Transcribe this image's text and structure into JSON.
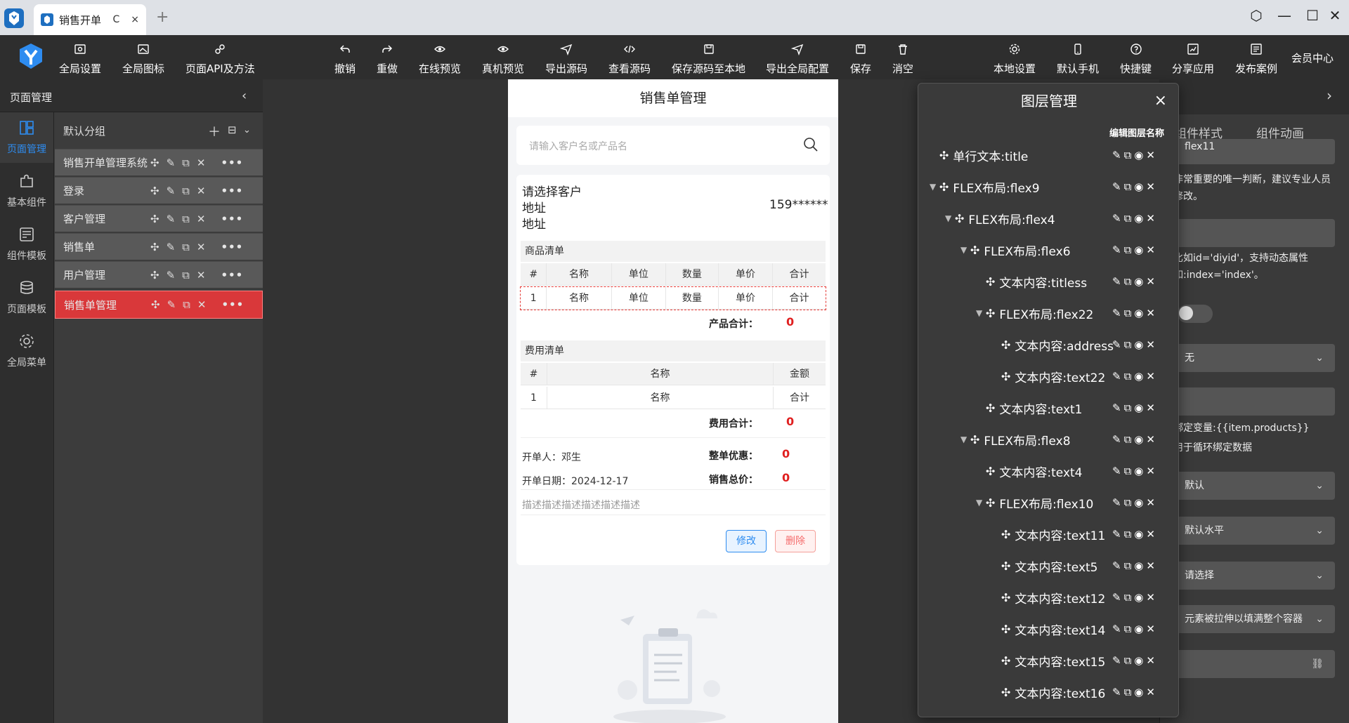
{
  "browser": {
    "tab_title": "销售开单",
    "tab_reload": "C",
    "tab_close": "×",
    "new_tab": "+"
  },
  "toolbar": {
    "left": [
      {
        "label": "全局设置",
        "icon": "settings-window-icon"
      },
      {
        "label": "全局图标",
        "icon": "image-icon"
      },
      {
        "label": "页面API及方法",
        "icon": "api-icon"
      }
    ],
    "center": [
      {
        "label": "撤销",
        "icon": "undo-icon"
      },
      {
        "label": "重做",
        "icon": "redo-icon"
      },
      {
        "label": "在线预览",
        "icon": "eye-icon"
      },
      {
        "label": "真机预览",
        "icon": "eye-icon"
      },
      {
        "label": "导出源码",
        "icon": "send-icon"
      },
      {
        "label": "查看源码",
        "icon": "code-icon"
      },
      {
        "label": "保存源码至本地",
        "icon": "save-icon"
      },
      {
        "label": "导出全局配置",
        "icon": "send-icon"
      },
      {
        "label": "保存",
        "icon": "save-icon"
      },
      {
        "label": "消空",
        "icon": "trash-icon"
      }
    ],
    "right": [
      {
        "label": "本地设置",
        "icon": "gear-icon"
      },
      {
        "label": "默认手机",
        "icon": "phone-icon"
      },
      {
        "label": "快捷键",
        "icon": "help-icon"
      },
      {
        "label": "分享应用",
        "icon": "share-icon"
      },
      {
        "label": "发布案例",
        "icon": "publish-icon"
      }
    ],
    "vip": "会员中心"
  },
  "left_nav": [
    {
      "label": "页面管理",
      "icon": "layout-icon",
      "active": true
    },
    {
      "label": "基本组件",
      "icon": "puzzle-icon",
      "active": false
    },
    {
      "label": "组件模板",
      "icon": "template-icon",
      "active": false
    },
    {
      "label": "页面模板",
      "icon": "database-icon",
      "active": false
    },
    {
      "label": "全局菜单",
      "icon": "gear-icon",
      "active": false
    }
  ],
  "page_panel": {
    "title": "页面管理",
    "group": "默认分组",
    "pages": [
      {
        "name": "销售开单管理系统",
        "active": false
      },
      {
        "name": "登录",
        "active": false
      },
      {
        "name": "客户管理",
        "active": false
      },
      {
        "name": "销售单",
        "active": false
      },
      {
        "name": "用户管理",
        "active": false
      },
      {
        "name": "销售单管理",
        "active": true
      }
    ]
  },
  "phone": {
    "title": "销售单管理",
    "search_placeholder": "请输入客户名或产品名",
    "customer": {
      "line1": "请选择客户",
      "line2": "地址",
      "line3": "地址",
      "phone": "159******"
    },
    "products": {
      "header": "商品清单",
      "columns": [
        "#",
        "名称",
        "单位",
        "数量",
        "单价",
        "合计"
      ],
      "row": [
        "1",
        "名称",
        "单位",
        "数量",
        "单价",
        "合计"
      ],
      "sum_label": "产品合计：",
      "sum_value": "0"
    },
    "fees": {
      "header": "费用清单",
      "columns": [
        "#",
        "名称",
        "金额"
      ],
      "row": [
        "1",
        "名称",
        "合计"
      ],
      "sum_label": "费用合计：",
      "sum_value": "0"
    },
    "footer": {
      "creator": "开单人：邓生",
      "date": "开单日期：2024-12-17",
      "discount_label": "整单优惠：",
      "discount_value": "0",
      "total_label": "销售总价：",
      "total_value": "0",
      "desc": "描述描述描述描述描述描述"
    },
    "btn_edit": "修改",
    "btn_delete": "删除"
  },
  "layers": {
    "title": "图层管理",
    "close": "×",
    "subtitle": "编辑图层名称",
    "items": [
      {
        "label": "单行文本:title",
        "depth": 0,
        "arrow": ""
      },
      {
        "label": "FLEX布局:flex9",
        "depth": 0,
        "arrow": "▼"
      },
      {
        "label": "FLEX布局:flex4",
        "depth": 1,
        "arrow": "▼"
      },
      {
        "label": "FLEX布局:flex6",
        "depth": 2,
        "arrow": "▼"
      },
      {
        "label": "文本内容:titless",
        "depth": 3,
        "arrow": ""
      },
      {
        "label": "FLEX布局:flex22",
        "depth": 3,
        "arrow": "▼"
      },
      {
        "label": "文本内容:address",
        "depth": 4,
        "arrow": ""
      },
      {
        "label": "文本内容:text22",
        "depth": 4,
        "arrow": ""
      },
      {
        "label": "文本内容:text1",
        "depth": 3,
        "arrow": ""
      },
      {
        "label": "FLEX布局:flex8",
        "depth": 2,
        "arrow": "▼"
      },
      {
        "label": "文本内容:text4",
        "depth": 3,
        "arrow": ""
      },
      {
        "label": "FLEX布局:flex10",
        "depth": 3,
        "arrow": "▼"
      },
      {
        "label": "文本内容:text11",
        "depth": 4,
        "arrow": ""
      },
      {
        "label": "文本内容:text5",
        "depth": 4,
        "arrow": ""
      },
      {
        "label": "文本内容:text12",
        "depth": 4,
        "arrow": ""
      },
      {
        "label": "文本内容:text14",
        "depth": 4,
        "arrow": ""
      },
      {
        "label": "文本内容:text15",
        "depth": 4,
        "arrow": ""
      },
      {
        "label": "文本内容:text16",
        "depth": 4,
        "arrow": ""
      }
    ]
  },
  "props": {
    "tabs": [
      "组件样式",
      "组件动画"
    ],
    "id_value": "flex11",
    "id_hint": "非常重要的唯一判断，建议专业人员修改。",
    "dyn_hint": "比如id='diyid'，支持动态属性如:index='index'。",
    "select1": "无",
    "bind_hint1": "绑定变量:{{item.products}}",
    "bind_hint2": "用于循环绑定数据",
    "select2": "默认",
    "select3": "默认水平",
    "select4": "请选择",
    "select5": "元素被拉伸以填满整个容器"
  },
  "colors": {
    "accent": "#2e8cf0",
    "active_page": "#d9383a",
    "price_red": "#e02020"
  }
}
